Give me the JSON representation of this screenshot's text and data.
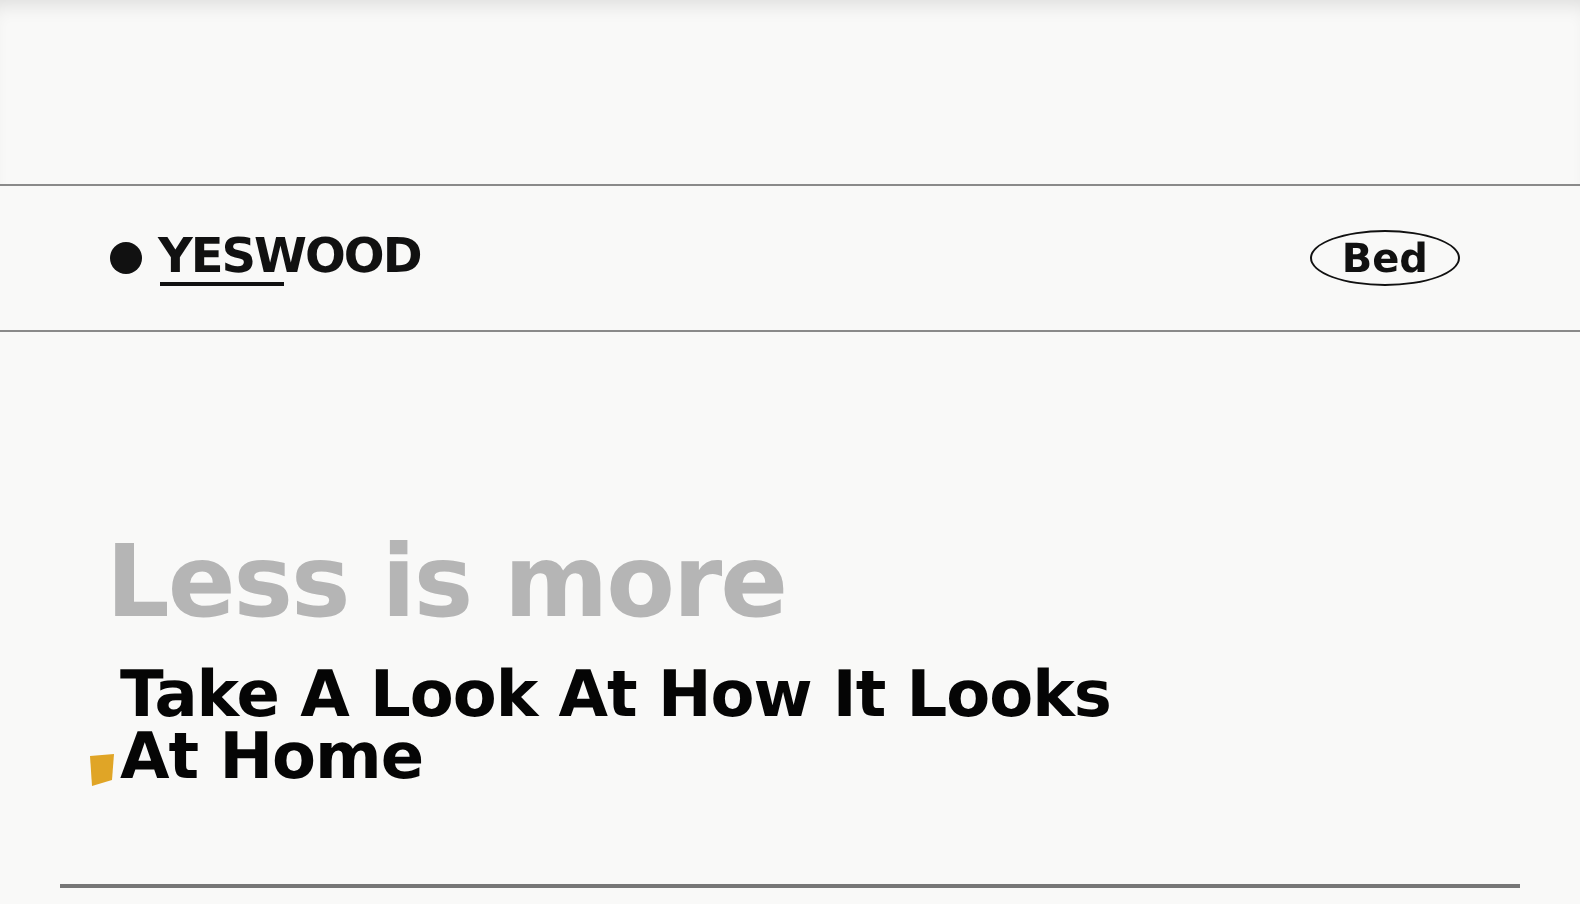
{
  "header": {
    "logo": "YESWOOD",
    "nav_button": "Bed"
  },
  "hero": {
    "tagline": "Less is more",
    "heading": "Take A Look At How It Looks At Home"
  }
}
